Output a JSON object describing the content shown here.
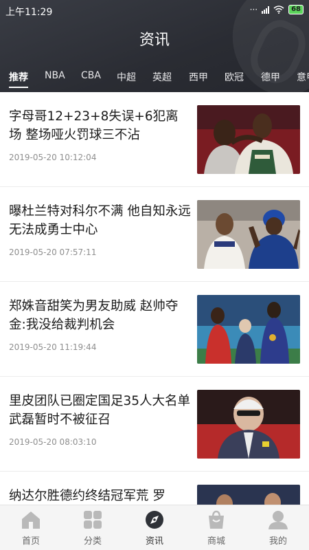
{
  "status": {
    "time": "上午11:29",
    "battery": "68"
  },
  "header": {
    "title": "资讯"
  },
  "tabs": [
    {
      "label": "推荐",
      "active": true
    },
    {
      "label": "NBA"
    },
    {
      "label": "CBA"
    },
    {
      "label": "中超"
    },
    {
      "label": "英超"
    },
    {
      "label": "西甲"
    },
    {
      "label": "欧冠"
    },
    {
      "label": "德甲"
    },
    {
      "label": "意甲"
    }
  ],
  "news": [
    {
      "title": "字母哥12+23+8失误+6犯离场 整场哑火罚球三不沾",
      "time": "2019-05-20 10:12:04"
    },
    {
      "title": "曝杜兰特对科尔不满 他自知永远无法成勇士中心",
      "time": "2019-05-20 07:57:11"
    },
    {
      "title": "郑姝音甜笑为男友助威 赵帅夺金:我没给裁判机会",
      "time": "2019-05-20 11:19:44"
    },
    {
      "title": "里皮团队已圈定国足35人大名单 武磊暂时不被征召",
      "time": "2019-05-20 08:03:10"
    },
    {
      "title": "纳达尔胜德约终结冠军荒 罗",
      "time": ""
    }
  ],
  "bottom_nav": [
    {
      "label": "首页",
      "icon": "home-icon"
    },
    {
      "label": "分类",
      "icon": "grid-icon"
    },
    {
      "label": "资讯",
      "icon": "compass-icon",
      "active": true
    },
    {
      "label": "商城",
      "icon": "shopping-bag-icon"
    },
    {
      "label": "我的",
      "icon": "user-icon"
    }
  ]
}
